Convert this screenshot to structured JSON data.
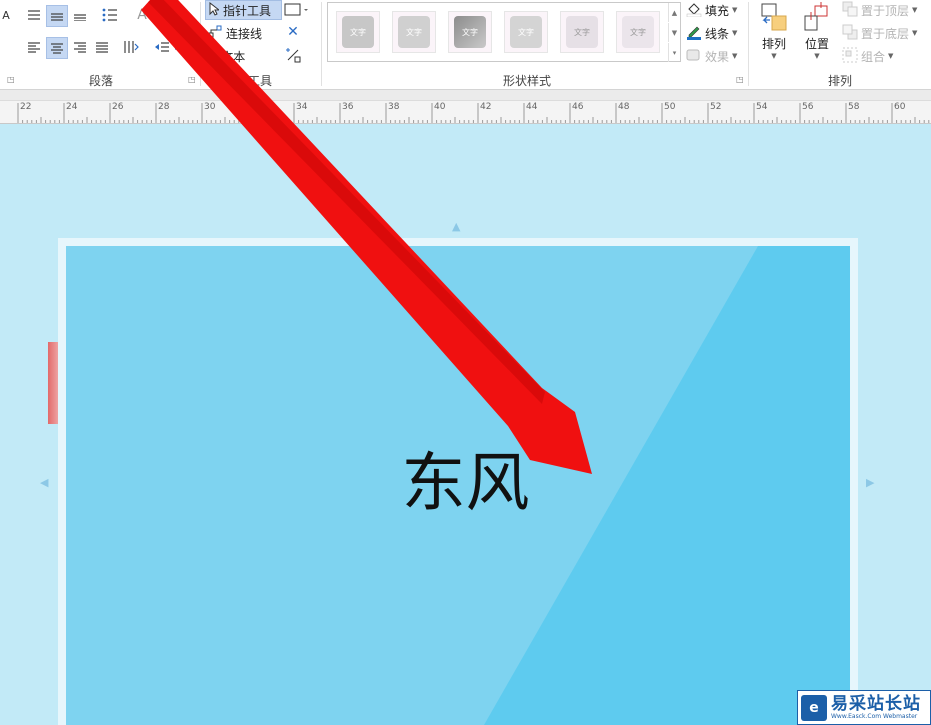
{
  "ribbon": {
    "paragraph": {
      "label": "段落"
    },
    "tools": {
      "label": "工具",
      "pointer_label": "指针工具",
      "connector_label": "连接线",
      "text_label": "文本"
    },
    "shape_styles": {
      "label": "形状样式",
      "swatch_text": [
        "文字",
        "文字",
        "文字",
        "文字",
        "文字",
        "文字"
      ],
      "fill_label": "填充",
      "line_label": "线条",
      "effects_label": "效果"
    },
    "arrange": {
      "label": "排列",
      "arrange_label": "排列",
      "position_label": "位置",
      "bring_to_front_label": "置于顶层",
      "send_to_back_label": "置于底层",
      "group_label": "组合"
    }
  },
  "ruler": {
    "ticks": [
      "22",
      "24",
      "26",
      "28",
      "30",
      "32",
      "34",
      "36",
      "38",
      "40",
      "42",
      "44",
      "46",
      "48",
      "50",
      "52",
      "54",
      "56",
      "58",
      "60"
    ]
  },
  "canvas": {
    "shape_text": "东风",
    "colors": {
      "shape_fill": "#7ed3f0",
      "shape_highlight": "#5ecbef",
      "canvas_bg": "#c2eaf7",
      "arrow": "#f01010"
    }
  },
  "watermark": {
    "title": "易采站长站",
    "subtitle": "Www.Easck.Com Webmaster"
  }
}
